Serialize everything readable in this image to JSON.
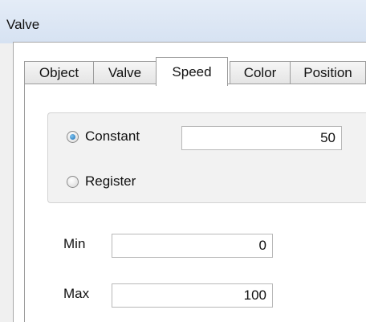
{
  "window": {
    "title": "Valve"
  },
  "tabs": [
    {
      "label": "Object",
      "active": false
    },
    {
      "label": "Valve",
      "active": false
    },
    {
      "label": "Speed",
      "active": true
    },
    {
      "label": "Color",
      "active": false
    },
    {
      "label": "Position",
      "active": false
    }
  ],
  "speed": {
    "mode_options": [
      {
        "label": "Constant",
        "selected": true
      },
      {
        "label": "Register",
        "selected": false
      }
    ],
    "constant_value": "50",
    "min_label": "Min",
    "min_value": "0",
    "max_label": "Max",
    "max_value": "100"
  },
  "icons": {
    "radio_selected": "radio-selected-icon",
    "radio_unselected": "radio-unselected-icon"
  },
  "colors": {
    "titlebar": "#dbe5f3",
    "radio_dot": "#1d6fb5"
  }
}
